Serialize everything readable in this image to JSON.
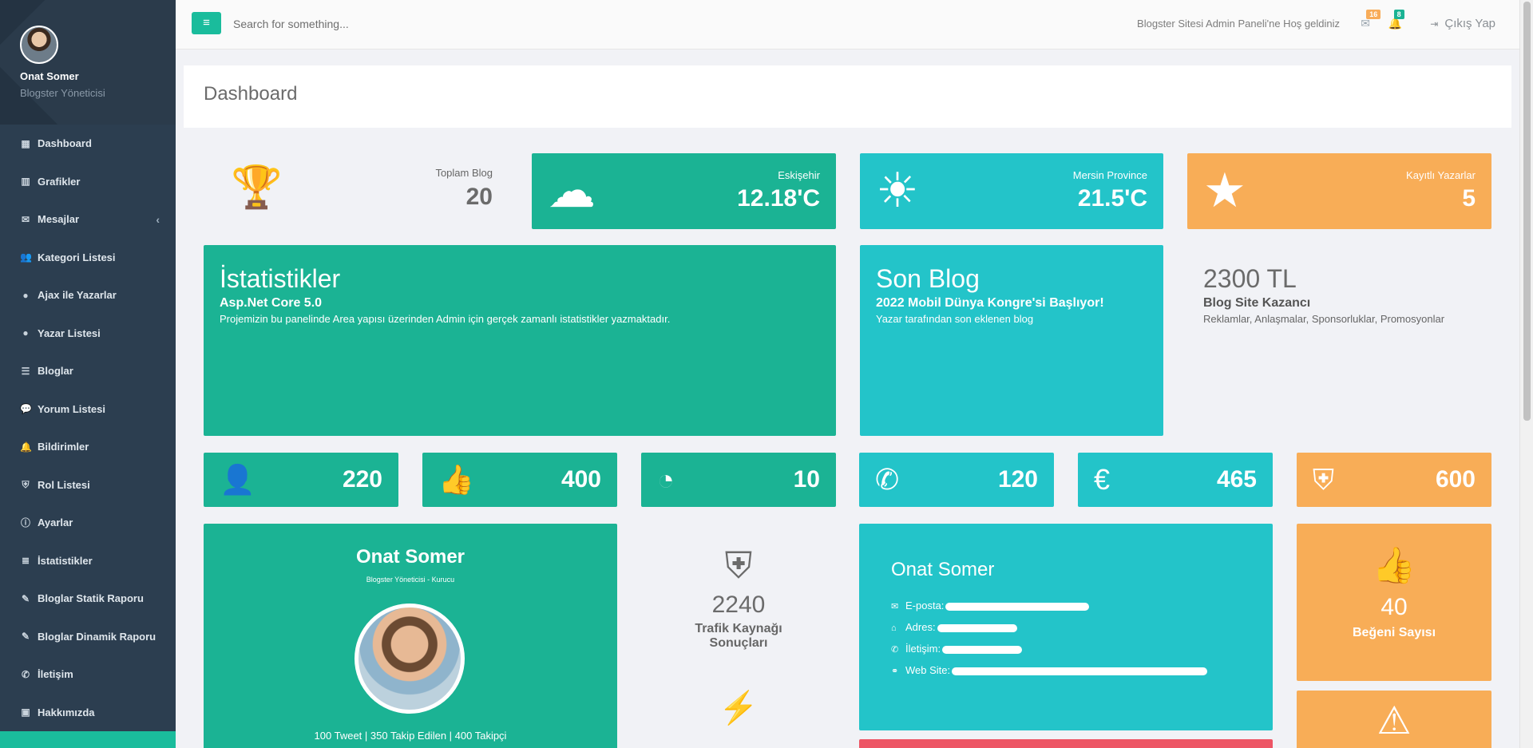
{
  "user": {
    "name": "Onat Somer",
    "role": "Blogster Yöneticisi"
  },
  "sidebar": {
    "items": [
      {
        "label": "Dashboard",
        "icon": "grid-icon"
      },
      {
        "label": "Grafikler",
        "icon": "bar-chart-icon"
      },
      {
        "label": "Mesajlar",
        "icon": "envelope-icon"
      },
      {
        "label": "Kategori Listesi",
        "icon": "users-icon"
      },
      {
        "label": "Ajax ile Yazarlar",
        "icon": "user-icon"
      },
      {
        "label": "Yazar Listesi",
        "icon": "user-icon"
      },
      {
        "label": "Bloglar",
        "icon": "list-icon"
      },
      {
        "label": "Yorum Listesi",
        "icon": "comment-icon"
      },
      {
        "label": "Bildirimler",
        "icon": "bell-icon"
      },
      {
        "label": "Rol Listesi",
        "icon": "shield-icon"
      },
      {
        "label": "Ayarlar",
        "icon": "info-icon"
      },
      {
        "label": "İstatistikler",
        "icon": "database-icon"
      },
      {
        "label": "Bloglar Statik Raporu",
        "icon": "pencil-icon"
      },
      {
        "label": "Bloglar Dinamik Raporu",
        "icon": "pencil-icon"
      },
      {
        "label": "İletişim",
        "icon": "phone-icon"
      },
      {
        "label": "Hakkımızda",
        "icon": "contact-card-icon"
      }
    ]
  },
  "topbar": {
    "search_placeholder": "Search for something...",
    "welcome": "Blogster Sitesi Admin Paneli'ne Hoş geldiniz",
    "mail_count": "16",
    "notification_count": "8",
    "logout": "Çıkış Yap",
    "badge_colors": {
      "mail": "#f8ac59",
      "notification": "#1ab394"
    }
  },
  "page": {
    "title": "Dashboard"
  },
  "stats": {
    "total_blog": {
      "label": "Toplam Blog",
      "value": "20",
      "icon": "trophy-icon"
    },
    "weather1": {
      "label": "Eskişehir",
      "value": "12.18'C",
      "icon": "cloud-icon"
    },
    "weather2": {
      "label": "Mersin Province",
      "value": "21.5'C",
      "icon": "sun-icon"
    },
    "writers": {
      "label": "Kayıtlı Yazarlar",
      "value": "5",
      "icon": "star-icon"
    }
  },
  "panels": {
    "stats": {
      "title": "İstatistikler",
      "subtitle": "Asp.Net Core 5.0",
      "desc": "Projemizin bu panelinde Area yapısı üzerinden Admin için gerçek zamanlı istatistikler yazmaktadır."
    },
    "last_blog": {
      "title": "Son Blog",
      "subtitle": "2022 Mobil Dünya Kongre'si Başlıyor!",
      "desc": "Yazar tarafından son eklenen blog"
    },
    "earnings": {
      "title": "2300 TL",
      "subtitle": "Blog Site Kazancı",
      "desc": "Reklamlar, Anlaşmalar, Sponsorluklar, Promosyonlar"
    }
  },
  "mini_stats": [
    {
      "icon": "user-icon",
      "value": "220"
    },
    {
      "icon": "thumbs-up-icon",
      "value": "400"
    },
    {
      "icon": "rss-icon",
      "value": "10"
    },
    {
      "icon": "phone-icon",
      "value": "120"
    },
    {
      "icon": "euro-icon",
      "value": "465"
    },
    {
      "icon": "shield-icon",
      "value": "600"
    }
  ],
  "profile_card": {
    "name": "Onat Somer",
    "role": "Blogster Yöneticisi - Kurucu",
    "stats": "100 Tweet | 350 Takip Edilen | 400 Takipçi"
  },
  "traffic": {
    "value": "2240",
    "label1": "Trafik Kaynağı",
    "label2": "Sonuçları"
  },
  "contact": {
    "name": "Onat Somer",
    "email_label": "E-posta:",
    "address_label": "Adres:",
    "phone_label": "İletişim:",
    "website_label": "Web Site:"
  },
  "likes": {
    "value": "40",
    "label": "Beğeni Sayısı"
  }
}
